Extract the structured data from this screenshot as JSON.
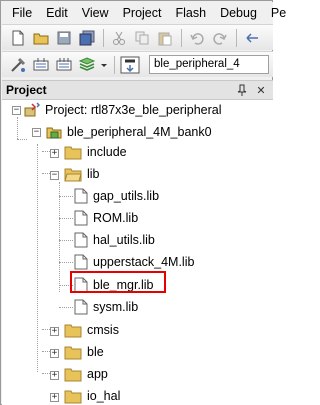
{
  "menu": [
    "File",
    "Edit",
    "View",
    "Project",
    "Flash",
    "Debug",
    "Pe"
  ],
  "toolbar": {
    "target_value": "ble_peripheral_4"
  },
  "panel": {
    "title": "Project",
    "pin_glyph": "ᵖ",
    "close_glyph": "✕"
  },
  "tree": {
    "expand_sign": "+",
    "collapse_sign": "−",
    "project_label": "Project: rtl87x3e_ble_peripheral",
    "target_label": "ble_peripheral_4M_bank0",
    "groups": {
      "include": "include",
      "lib": "lib",
      "cmsis": "cmsis",
      "ble": "ble",
      "app": "app",
      "io_hal": "io_hal"
    },
    "lib_files": [
      "gap_utils.lib",
      "ROM.lib",
      "hal_utils.lib",
      "upperstack_4M.lib",
      "ble_mgr.lib",
      "sysm.lib"
    ],
    "highlighted_file": "ble_mgr.lib"
  },
  "colors": {
    "highlight_border": "#e60000",
    "folder": "#e8c35a"
  }
}
